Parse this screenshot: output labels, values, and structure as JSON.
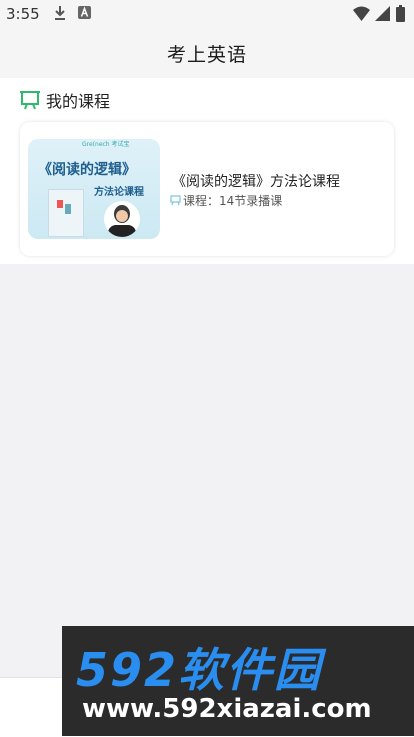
{
  "status_bar": {
    "time": "3:55",
    "icons": [
      "download-icon",
      "a-icon",
      "wifi-icon",
      "signal-icon",
      "battery-icon"
    ]
  },
  "app_bar": {
    "title": "考上英语"
  },
  "my_courses": {
    "section_title": "我的课程",
    "courses": [
      {
        "cover": {
          "logo_text": "Gre(nech 考试宝",
          "title": "《阅读的逻辑》",
          "subtitle": "方法论课程"
        },
        "name": "《阅读的逻辑》方法论课程",
        "meta": "课程：14节录播课"
      }
    ]
  },
  "watermark": {
    "brand": "592软件园",
    "url": "www.592xiazai.com"
  },
  "colors": {
    "accent_green": "#2fb96b",
    "brand_blue": "#2a8ef0",
    "background": "#f2f2f4"
  }
}
